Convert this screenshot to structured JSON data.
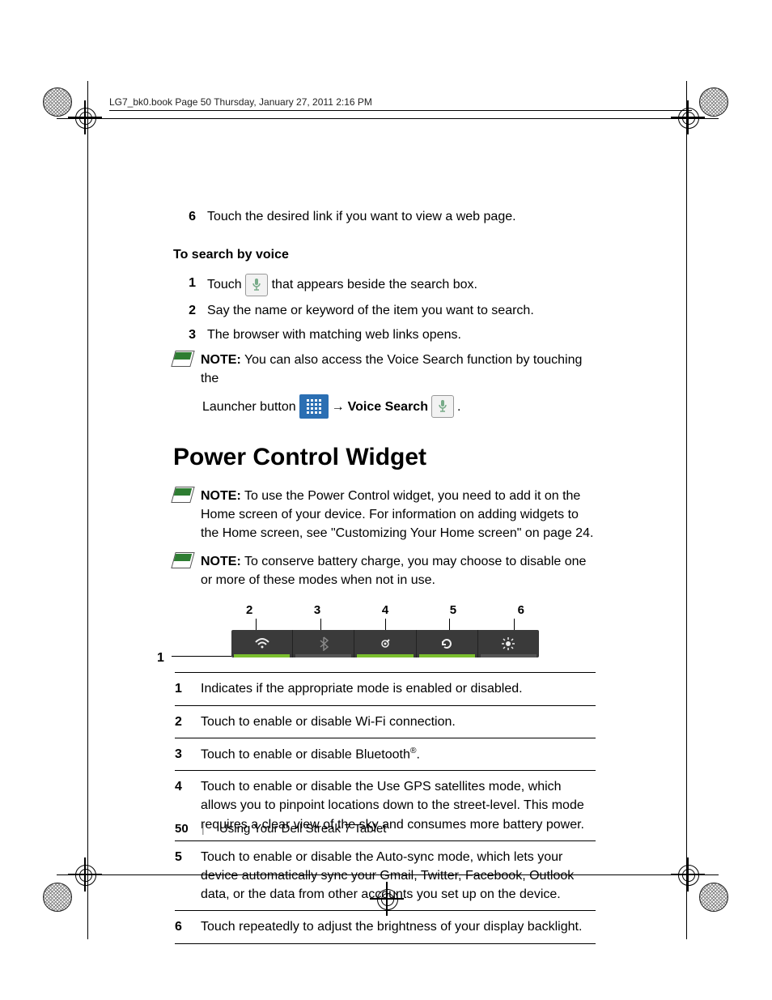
{
  "runhead": "LG7_bk0.book  Page 50  Thursday, January 27, 2011  2:16 PM",
  "step6": {
    "n": "6",
    "t": "Touch the desired link if you want to view a web page."
  },
  "voice": {
    "heading": "To search by voice",
    "s1n": "1",
    "s1a": "Touch ",
    "s1b": " that appears beside the search box.",
    "s2n": "2",
    "s2t": "Say the name or keyword of the item you want to search.",
    "s3n": "3",
    "s3t": "The browser with matching web links opens."
  },
  "note_vs": {
    "label": "NOTE:",
    "text": " You can also access the Voice Search function by touching the",
    "cont_a": "Launcher button ",
    "arrow": "→",
    "vs_label": "Voice Search",
    "period": "."
  },
  "section": "Power Control Widget",
  "note_add": {
    "label": "NOTE:",
    "text": " To use the Power Control widget, you need to add it on the Home screen of your device. For information on adding widgets to the Home screen, see \"Customizing Your Home screen\" on page 24."
  },
  "note_batt": {
    "label": "NOTE:",
    "text": " To conserve battery charge, you may choose to disable one or more of these modes when not in use."
  },
  "callouts": {
    "c1": "1",
    "c2": "2",
    "c3": "3",
    "c4": "4",
    "c5": "5",
    "c6": "6"
  },
  "table": {
    "r1k": "1",
    "r1v": "Indicates if the appropriate mode is enabled or disabled.",
    "r2k": "2",
    "r2v": "Touch to enable or disable Wi-Fi connection.",
    "r3k": "3",
    "r3v_a": "Touch to enable or disable Bluetooth",
    "r3v_b": ".",
    "r4k": "4",
    "r4v": "Touch to enable or disable the Use GPS satellites mode, which allows you to pinpoint locations down to the street-level. This mode requires a clear view of the sky and consumes more battery power.",
    "r5k": "5",
    "r5v": "Touch to enable or disable the Auto-sync mode, which lets your device automatically sync your Gmail, Twitter, Facebook, Outlook data, or the data from other accounts you set up on the device.",
    "r6k": "6",
    "r6v": "Touch repeatedly to adjust the brightness of your display backlight."
  },
  "footer": {
    "page": "50",
    "chapter": "Using Your Dell Streak 7 Tablet"
  }
}
